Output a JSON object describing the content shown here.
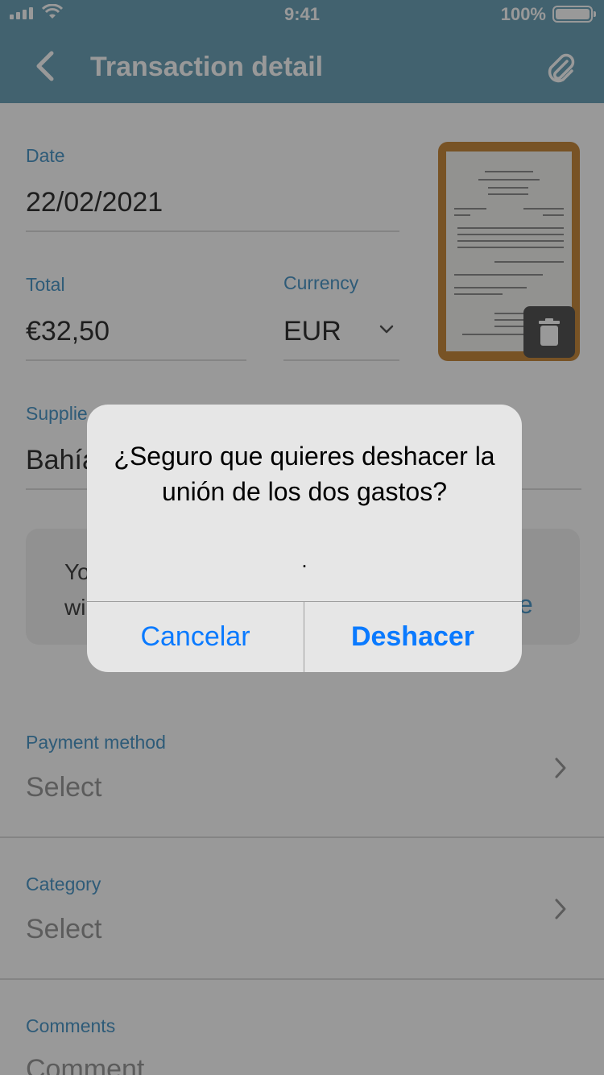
{
  "status_bar": {
    "time": "9:41",
    "battery": "100%"
  },
  "nav": {
    "title": "Transaction detail"
  },
  "form": {
    "date": {
      "label": "Date",
      "value": "22/02/2021"
    },
    "total": {
      "label": "Total",
      "value": "€32,50"
    },
    "currency": {
      "label": "Currency",
      "value": "EUR"
    },
    "supplier": {
      "label": "Supplie",
      "value": "Bahía"
    },
    "info_box": {
      "line1": "Yo",
      "line2": "wi",
      "link": "e"
    },
    "payment_method": {
      "label": "Payment method",
      "placeholder": "Select"
    },
    "category": {
      "label": "Category",
      "placeholder": "Select"
    },
    "comments": {
      "label": "Comments",
      "placeholder": "Comment"
    }
  },
  "alert": {
    "title": "¿Seguro que quieres deshacer la unión de los dos gastos?",
    "message": ".",
    "cancel_label": "Cancelar",
    "confirm_label": "Deshacer"
  },
  "colors": {
    "accent": "#4E98C8",
    "header": "#6FA4B9",
    "alert_button": "#0A7AFF"
  },
  "icons": [
    "back-chevron-icon",
    "paperclip-icon",
    "trash-icon",
    "chevron-right-icon",
    "chevron-down-icon",
    "wifi-icon",
    "signal-icon",
    "battery-icon"
  ]
}
